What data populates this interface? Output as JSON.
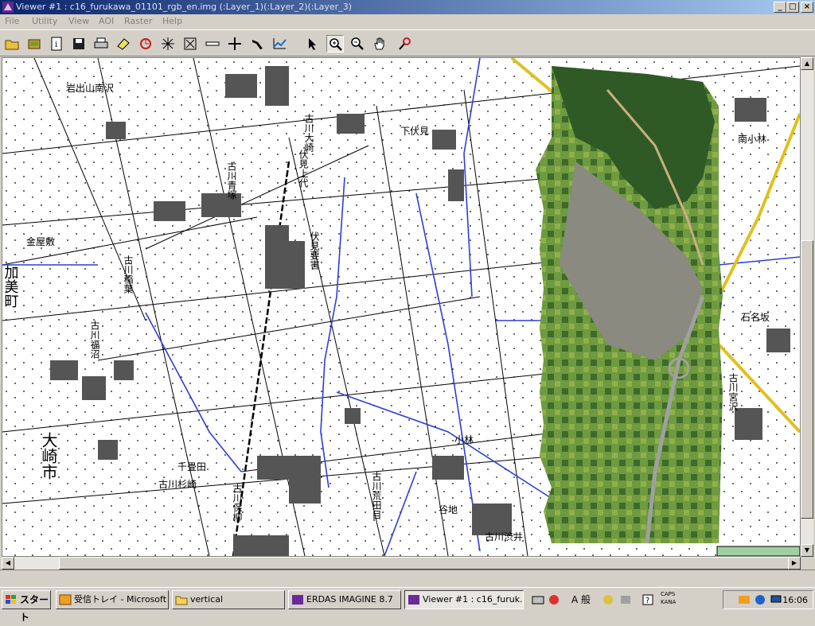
{
  "window": {
    "title": "Viewer #1 : c16_furukawa_01101_rgb_en.img (:Layer_1)(:Layer_2)(:Layer_3)"
  },
  "menu": [
    {
      "label": "File"
    },
    {
      "label": "Utility"
    },
    {
      "label": "View"
    },
    {
      "label": "AOI"
    },
    {
      "label": "Raster"
    },
    {
      "label": "Help"
    }
  ],
  "toolbar": [
    {
      "icon": "open-folder-icon"
    },
    {
      "icon": "open-layer-icon"
    },
    {
      "icon": "info-icon"
    },
    {
      "icon": "save-icon"
    },
    {
      "icon": "print-icon"
    },
    {
      "icon": "eraser-icon"
    },
    {
      "icon": "rotate-icon"
    },
    {
      "icon": "zoom-full-icon"
    },
    {
      "icon": "fit-window-icon"
    },
    {
      "icon": "measure-icon"
    },
    {
      "icon": "crosshair-icon"
    },
    {
      "icon": "pick-icon"
    },
    {
      "icon": "chart-icon"
    },
    {
      "icon": "select-arrow-icon"
    },
    {
      "icon": "zoom-in-icon"
    },
    {
      "icon": "zoom-out-icon"
    },
    {
      "icon": "pan-hand-icon"
    },
    {
      "icon": "inquire-cursor-icon"
    }
  ],
  "map_labels": [
    {
      "text": "岩出山南沢"
    },
    {
      "text": "古川大崎"
    },
    {
      "text": "下伏見"
    },
    {
      "text": "伏見上代"
    },
    {
      "text": "古川青塚"
    },
    {
      "text": "伏見要害"
    },
    {
      "text": "金屋敷"
    },
    {
      "text": "加美町"
    },
    {
      "text": "古川稲葉"
    },
    {
      "text": "古川福沼"
    },
    {
      "text": "大崎市"
    },
    {
      "text": "千畳田"
    },
    {
      "text": "古川杉崎"
    },
    {
      "text": "古川保柳"
    },
    {
      "text": "古川荒田目"
    },
    {
      "text": "石名坂"
    },
    {
      "text": "南小林"
    },
    {
      "text": "古川宮沢"
    },
    {
      "text": "古川渋井"
    },
    {
      "text": "小林"
    },
    {
      "text": "谷地"
    }
  ],
  "statusbar": {
    "text": ""
  },
  "taskbar": {
    "start_label": "スタート",
    "tasks": [
      {
        "label": "受信トレイ - Microsoft ..."
      },
      {
        "label": "vertical"
      },
      {
        "label": "ERDAS IMAGINE 8.7"
      },
      {
        "label": "Viewer #1 : c16_furuk..."
      }
    ],
    "ime_mode": "A 般",
    "caps": "CAPS",
    "kana": "KANA",
    "clock": "16:06"
  },
  "colors": {
    "title_start": "#0a246a",
    "title_end": "#a6caf0",
    "chrome": "#d4d0c8",
    "map_blue": "#2a3fd8",
    "settlement": "#555555",
    "orthophoto_green": "#5f8a3a"
  }
}
